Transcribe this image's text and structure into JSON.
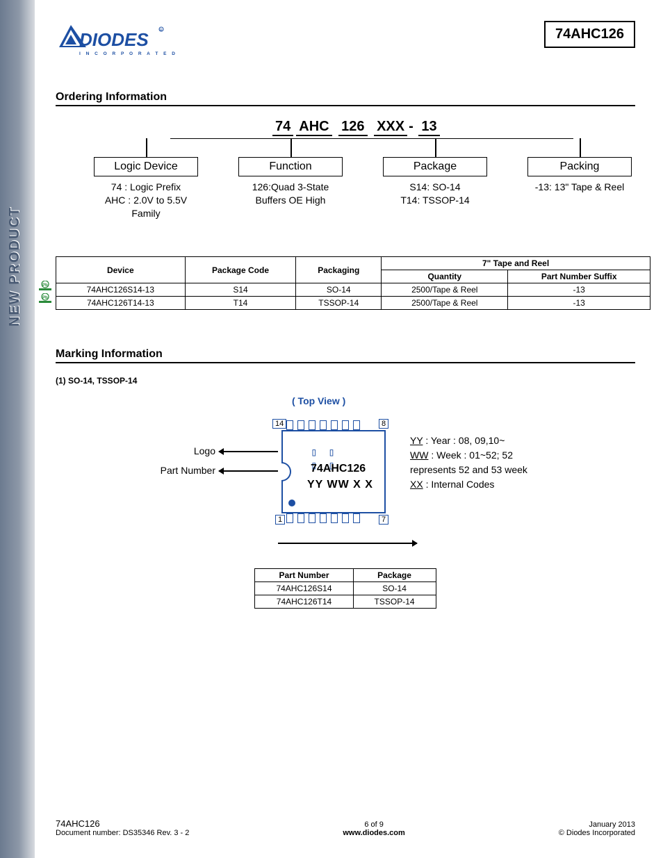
{
  "header": {
    "part_number_box": "74AHC126",
    "logo_tagline": "I N C O R P O R A T E D"
  },
  "sidebar_text": "NEW PRODUCT",
  "ordering": {
    "title": "Ordering Information",
    "part_string": {
      "a": "74",
      "b": "AHC",
      "c": "126",
      "d": "XXX",
      "dash": "-",
      "e": "13"
    },
    "cols": [
      {
        "box": "Logic Device",
        "desc": "74 : Logic Prefix\nAHC : 2.0V to 5.5V\nFamily"
      },
      {
        "box": "Function",
        "desc": "126:Quad 3-State\nBuffers OE High"
      },
      {
        "box": "Package",
        "desc": "S14: SO-14\nT14: TSSOP-14"
      },
      {
        "box": "Packing",
        "desc": "-13: 13\" Tape & Reel"
      }
    ],
    "table": {
      "h_device": "Device",
      "h_pkgcode": "Package Code",
      "h_pkg": "Packaging",
      "h_tape": "7\" Tape and Reel",
      "h_qty": "Quantity",
      "h_suffix": "Part Number Suffix",
      "rows": [
        {
          "device": "74AHC126S14-13",
          "code": "S14",
          "pkg": "SO-14",
          "qty": "2500/Tape & Reel",
          "suffix": "-13"
        },
        {
          "device": "74AHC126T14-13",
          "code": "T14",
          "pkg": "TSSOP-14",
          "qty": "2500/Tape & Reel",
          "suffix": "-13"
        }
      ]
    }
  },
  "marking": {
    "title": "Marking Information",
    "sub": "(1) SO-14, TSSOP-14",
    "topview": "( Top View )",
    "chip_line1": "74AHC126",
    "chip_line2": "YY WW X X",
    "pin14": "14",
    "pin8": "8",
    "pin1": "1",
    "pin7": "7",
    "label_logo": "Logo",
    "label_pn": "Part Number",
    "legend_yy_l": "YY",
    "legend_yy": " : Year : 08, 09,10~",
    "legend_ww_l": "WW",
    "legend_ww": " : Week : 01~52; 52",
    "legend_ww2": "represents 52 and 53 week",
    "legend_xx_l": "XX",
    "legend_xx": " :  Internal Codes",
    "table": {
      "h1": "Part Number",
      "h2": "Package",
      "rows": [
        {
          "pn": "74AHC126S14",
          "pkg": "SO-14"
        },
        {
          "pn": "74AHC126T14",
          "pkg": "TSSOP-14"
        }
      ]
    }
  },
  "footer": {
    "left_pn": "74AHC126",
    "left_doc": "Document number: DS35346  Rev. 3 - 2",
    "page": "6 of 9",
    "url": "www.diodes.com",
    "date": "January 2013",
    "copy": "© Diodes Incorporated"
  }
}
